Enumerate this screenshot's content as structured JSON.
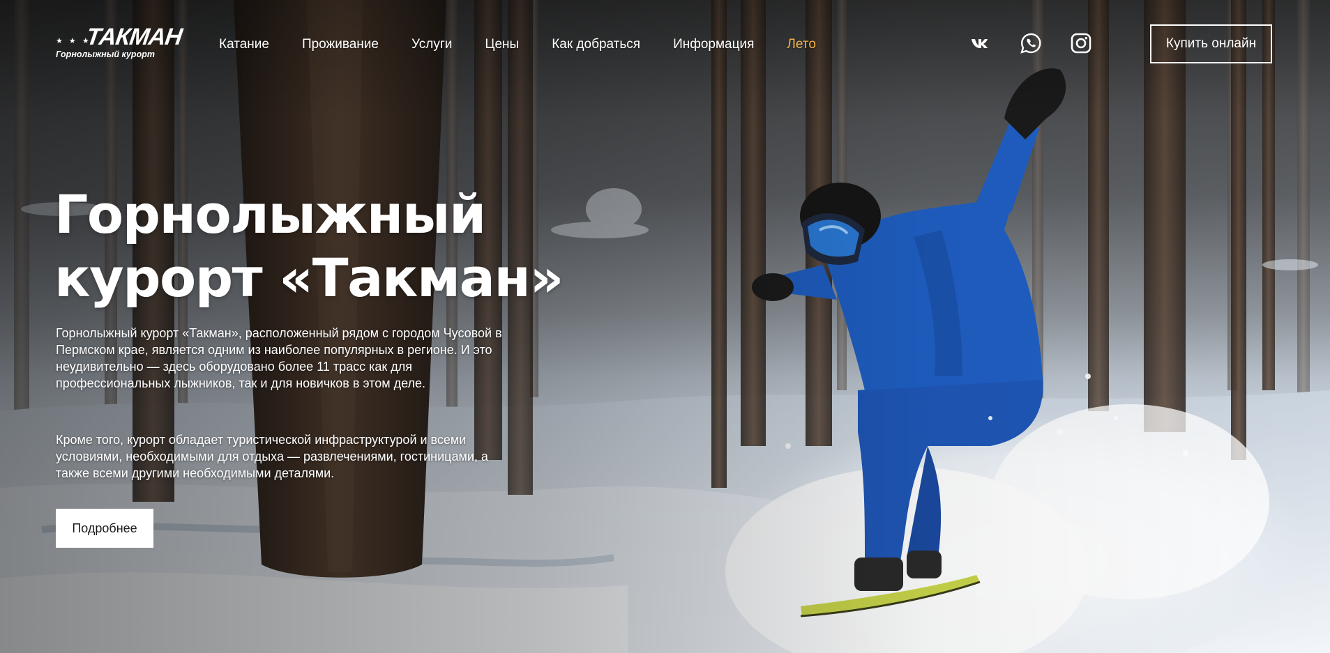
{
  "header": {
    "logo": {
      "mark": "ТАКМАН",
      "stars": "★ ★ ★",
      "caption": "Горнолыжный курорт"
    },
    "nav": [
      {
        "label": "Катание"
      },
      {
        "label": "Проживание"
      },
      {
        "label": "Услуги"
      },
      {
        "label": "Цены"
      },
      {
        "label": "Как добраться"
      },
      {
        "label": "Информация"
      },
      {
        "label": "Лето",
        "accent": true
      }
    ],
    "social": [
      {
        "icon": "vk-icon"
      },
      {
        "icon": "whatsapp-icon"
      },
      {
        "icon": "instagram-icon"
      }
    ],
    "buy_label": "Купить онлайн"
  },
  "hero": {
    "title_line1": "Горнолыжный",
    "title_line2": "курорт «Такман»",
    "paragraph1": "Горнолыжный курорт «Такман», расположенный рядом с городом Чусовой в Пермском крае, является одним из наиболее популярных в регионе. И это неудивительно — здесь оборудовано более 11 трасс как для профессиональных лыжников, так и для новичков в этом деле.",
    "paragraph2": "Кроме того, курорт обладает туристической инфраструктурой и всеми условиями, необходимыми для отдыха — развлечениями, гостиницами, а также всеми другими необходимыми деталями.",
    "more_label": "Подробнее"
  },
  "colors": {
    "accent": "#f4b548",
    "text": "#ffffff",
    "button_bg": "#ffffff",
    "button_text": "#1c1c1c"
  }
}
